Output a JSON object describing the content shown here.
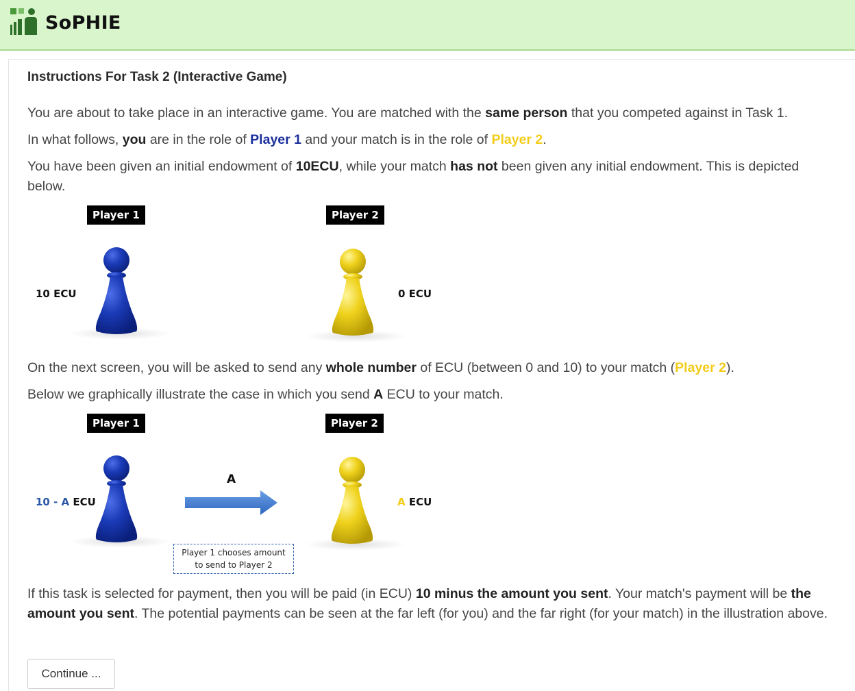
{
  "header": {
    "brand": "SoPHIE"
  },
  "page": {
    "title": "Instructions For Task 2 (Interactive Game)",
    "p1": {
      "a": "You are about to take place in an interactive game. You are matched with the ",
      "b": "same person",
      "c": " that you competed against in Task 1."
    },
    "p2": {
      "a": "In what follows, ",
      "b": "you",
      "c": " are in the role of ",
      "d": "Player 1",
      "e": " and your match is in the role of ",
      "f": "Player 2",
      "g": "."
    },
    "p3": {
      "a": "You have been given an initial endowment of ",
      "b": "10ECU",
      "c": ", while your match ",
      "d": "has not",
      "e": " been given any initial endowment. This is depicted below."
    },
    "p4": {
      "a": "On the next screen, you will be asked to send any ",
      "b": "whole number",
      "c": " of ECU (between 0 and 10) to your match (",
      "d": "Player 2",
      "e": ")."
    },
    "p5": {
      "a": "Below we graphically illustrate the case in which you send ",
      "b": "A",
      "c": " ECU to your match."
    },
    "p6": {
      "a": "If this task is selected for payment, then you will be paid (in ECU) ",
      "b": "10 minus the amount you sent",
      "c": ". Your match's payment will be ",
      "d": "the amount you sent",
      "e": ". The potential payments can be seen at the far left (for you) and the far right (for your match) in the illustration above."
    }
  },
  "figure1": {
    "player1_tag": "Player 1",
    "player2_tag": "Player 2",
    "player1_amount": "10 ECU",
    "player2_amount": "0 ECU"
  },
  "figure2": {
    "player1_tag": "Player 1",
    "player2_tag": "Player 2",
    "left_amount": {
      "a": "10 - A",
      "b": " ECU"
    },
    "right_amount": {
      "a": "A",
      "b": " ECU"
    },
    "arrow_label": "A",
    "note_line1": "Player 1 chooses amount",
    "note_line2": "to send to Player 2"
  },
  "buttons": {
    "continue": "Continue ..."
  },
  "colors": {
    "player1": "#1a2e9c",
    "player2": "#f3cc1a",
    "header_bg": "#d9f5cc"
  }
}
